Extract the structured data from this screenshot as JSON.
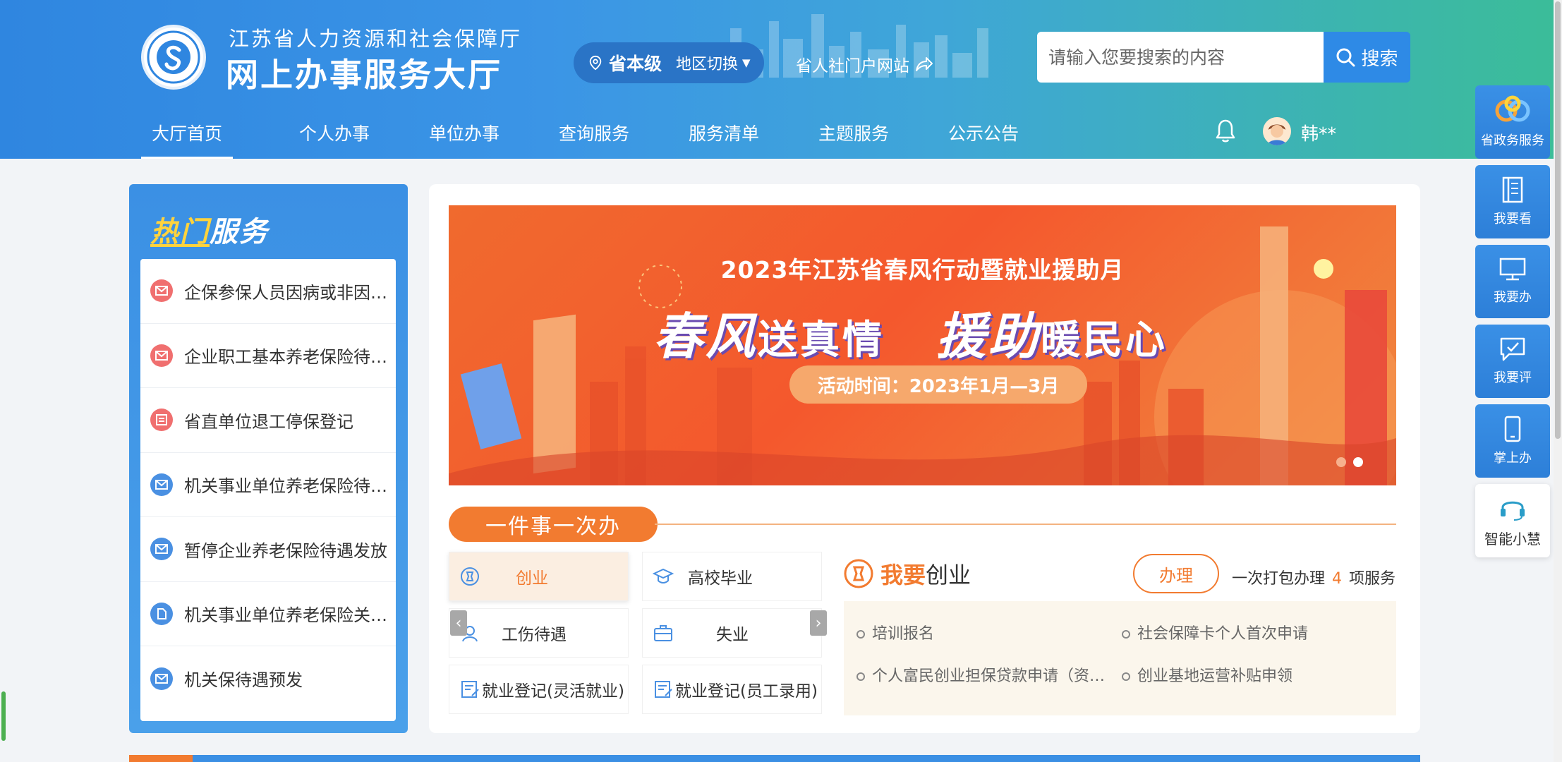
{
  "header": {
    "org_name": "江苏省人力资源和社会保障厅",
    "hall_name": "网上办事服务大厅",
    "region_level": "省本级",
    "region_switch": "地区切换",
    "portal_link": "省人社门户网站",
    "search_placeholder": "请输入您要搜索的内容",
    "search_button": "搜索",
    "user_name": "韩**"
  },
  "nav": [
    {
      "label": "大厅首页",
      "active": true
    },
    {
      "label": "个人办事"
    },
    {
      "label": "单位办事"
    },
    {
      "label": "查询服务"
    },
    {
      "label": "服务清单"
    },
    {
      "label": "主题服务"
    },
    {
      "label": "公示公告"
    }
  ],
  "hot_services": {
    "title_part1": "热门",
    "title_part2": "服务",
    "items": [
      {
        "label": "企保参保人员因病或非因工死亡",
        "icon": "mail-icon",
        "color": "#f06f6f"
      },
      {
        "label": "企业职工基本养老保险待遇申领",
        "icon": "mail-icon",
        "color": "#f06f6f"
      },
      {
        "label": "省直单位退工停保登记",
        "icon": "form-icon",
        "color": "#f06f6f"
      },
      {
        "label": "机关事业单位养老保险待遇申领",
        "icon": "mail-icon",
        "color": "#4a90e2"
      },
      {
        "label": "暂停企业养老保险待遇发放",
        "icon": "mail-icon",
        "color": "#4a90e2"
      },
      {
        "label": "机关事业单位养老保险关系转移",
        "icon": "doc-icon",
        "color": "#4a90e2"
      },
      {
        "label": "机关保待遇预发",
        "icon": "mail-icon",
        "color": "#4a90e2"
      }
    ]
  },
  "banner": {
    "top_line": "2023年江苏省春风行动暨就业援助月",
    "slogan_a": "春风",
    "slogan_b": "送真情",
    "slogan_c": "援助",
    "slogan_d": "暖民心",
    "time_text": "活动时间：2023年1月—3月"
  },
  "onething": {
    "tag": "一件事一次办",
    "categories": [
      {
        "label": "创业",
        "icon": "startup-icon",
        "active": true
      },
      {
        "label": "高校毕业",
        "icon": "graduate-cap-icon"
      },
      {
        "label": "工伤待遇",
        "icon": "injury-icon"
      },
      {
        "label": "失业",
        "icon": "briefcase-icon"
      },
      {
        "label": "就业登记(灵活就业)",
        "icon": "register-icon"
      },
      {
        "label": "就业登记(员工录用)",
        "icon": "register-icon"
      }
    ],
    "detail": {
      "title_prefix": "我要",
      "title_suffix": "创业",
      "apply_button": "办理",
      "pack_prefix": "一次打包办理",
      "pack_count": "4",
      "pack_suffix": "项服务",
      "services": [
        "培训报名",
        "社会保障卡个人首次申请",
        "个人富民创业担保贷款申请（资格审核）",
        "创业基地运营补贴申领"
      ]
    }
  },
  "float_bar": [
    {
      "label": "省政务服务",
      "icon": "gov-logo-icon"
    },
    {
      "label": "我要看",
      "icon": "book-icon"
    },
    {
      "label": "我要办",
      "icon": "monitor-icon"
    },
    {
      "label": "我要评",
      "icon": "comment-icon"
    },
    {
      "label": "掌上办",
      "icon": "phone-icon"
    },
    {
      "label": "智能小慧",
      "icon": "headset-icon"
    }
  ],
  "colors": {
    "primary": "#2e8ae6",
    "accent": "#f27b30",
    "header_gradient_end": "#3bbd98"
  }
}
